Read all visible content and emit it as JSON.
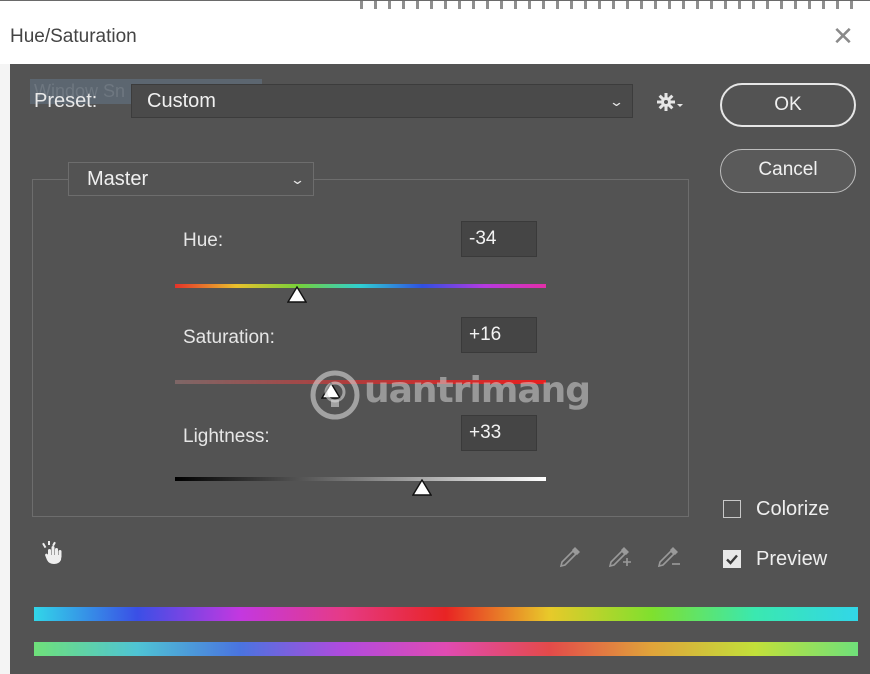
{
  "window": {
    "title": "Hue/Saturation",
    "close_glyph": "✕"
  },
  "ghost_overlay": "Window Sn",
  "preset": {
    "label": "Preset:",
    "value": "Custom",
    "settings_icon": "gear-icon"
  },
  "buttons": {
    "ok": "OK",
    "cancel": "Cancel"
  },
  "channel": {
    "value": "Master"
  },
  "adjustments": {
    "hue": {
      "label": "Hue:",
      "value": "-34",
      "slider_fraction": 0.33
    },
    "saturation": {
      "label": "Saturation:",
      "value": "+16",
      "slider_fraction": 0.42
    },
    "lightness": {
      "label": "Lightness:",
      "value": "+33",
      "slider_fraction": 0.665
    }
  },
  "options": {
    "colorize": {
      "label": "Colorize",
      "checked": false
    },
    "preview": {
      "label": "Preview",
      "checked": true
    }
  },
  "tools": [
    "hand-tool-icon",
    "eyedropper-icon",
    "eyedropper-plus-icon",
    "eyedropper-minus-icon"
  ],
  "watermark": "uantrimang",
  "colors": {
    "background": "#535353",
    "field": "#454545",
    "text": "#eeeeee"
  }
}
